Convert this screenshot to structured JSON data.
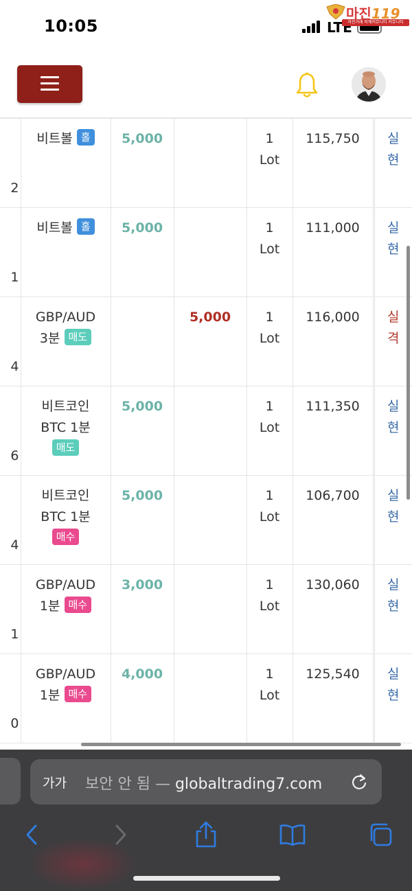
{
  "status_bar": {
    "time": "10:05",
    "network": "LTE",
    "watermark": {
      "title": "마진",
      "number": "119",
      "subtitle": "마진거래 피해커뮤니티 커뮤니티"
    }
  },
  "header": {
    "menu_icon": "hamburger-icon",
    "bell_icon": "bell-icon",
    "bell_color": "#f5c518",
    "menu_color": "#8e2019"
  },
  "table": {
    "rows": [
      {
        "idx_tail": "2",
        "product": "비트볼",
        "product2": "",
        "badge": "홀",
        "badge_type": "odd",
        "profit": "5,000",
        "loss": "",
        "qty": "1",
        "unit": "Lot",
        "price": "115,750",
        "result1": "실",
        "result2": "현",
        "result_type": "realized"
      },
      {
        "idx_tail": "1",
        "product": "비트볼",
        "product2": "",
        "badge": "홀",
        "badge_type": "odd",
        "profit": "5,000",
        "loss": "",
        "qty": "1",
        "unit": "Lot",
        "price": "111,000",
        "result1": "실",
        "result2": "현",
        "result_type": "realized"
      },
      {
        "idx_tail": "4",
        "product": "GBP/AUD",
        "product2": "3분",
        "badge": "매도",
        "badge_type": "sell",
        "profit": "",
        "loss": "5,000",
        "qty": "1",
        "unit": "Lot",
        "price": "116,000",
        "result1": "실",
        "result2": "격",
        "result_type": "fail"
      },
      {
        "idx_tail": "6",
        "product": "비트코인",
        "product2": "BTC 1분",
        "badge": "매도",
        "badge_type": "sell",
        "profit": "5,000",
        "loss": "",
        "qty": "1",
        "unit": "Lot",
        "price": "111,350",
        "result1": "실",
        "result2": "현",
        "result_type": "realized"
      },
      {
        "idx_tail": "4",
        "product": "비트코인",
        "product2": "BTC 1분",
        "badge": "매수",
        "badge_type": "buy",
        "profit": "5,000",
        "loss": "",
        "qty": "1",
        "unit": "Lot",
        "price": "106,700",
        "result1": "실",
        "result2": "현",
        "result_type": "realized"
      },
      {
        "idx_tail": "1",
        "product": "GBP/AUD",
        "product2": "1분",
        "badge": "매수",
        "badge_type": "buy",
        "profit": "3,000",
        "loss": "",
        "qty": "1",
        "unit": "Lot",
        "price": "130,060",
        "result1": "실",
        "result2": "현",
        "result_type": "realized"
      },
      {
        "idx_tail": "0",
        "product": "GBP/AUD",
        "product2": "1분",
        "badge": "매수",
        "badge_type": "buy",
        "profit": "4,000",
        "loss": "",
        "qty": "1",
        "unit": "Lot",
        "price": "125,540",
        "result1": "실",
        "result2": "현",
        "result_type": "realized"
      }
    ]
  },
  "browser": {
    "text_size_label": "가가",
    "security_label": "보안 안 됨",
    "separator": "—",
    "domain": "globaltrading7.com",
    "icons": [
      "back-icon",
      "forward-icon",
      "share-icon",
      "bookmarks-icon",
      "tabs-icon",
      "reload-icon"
    ]
  },
  "colors": {
    "profit": "#6cb3a8",
    "loss": "#b02e25",
    "realized": "#3a6ba8",
    "badge_odd": "#3f8fdc",
    "badge_sell": "#5ccdbb",
    "badge_buy": "#ea4a8e",
    "toolbar": "#3d3d3f",
    "toolbar_icon": "#2f7ce0"
  }
}
